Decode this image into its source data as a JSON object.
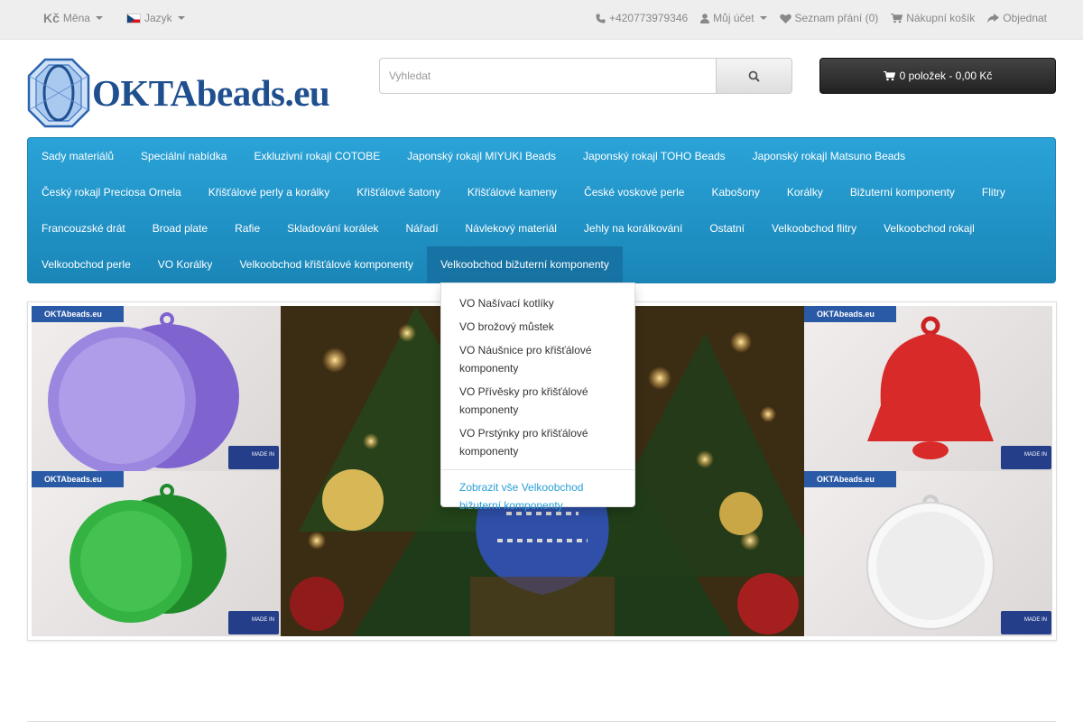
{
  "topbar": {
    "currency_symbol": "Kč",
    "currency_label": "Měna",
    "language_label": "Jazyk",
    "phone": "+420773979346",
    "account": "Můj účet",
    "wishlist": "Seznam přání (0)",
    "cart": "Nákupní košík",
    "checkout": "Objednat"
  },
  "logo": {
    "text": "OKTAbeads.eu"
  },
  "search": {
    "placeholder": "Vyhledat"
  },
  "cart_button": {
    "label": "0 položek - 0,00 Kč"
  },
  "menu": {
    "row1": [
      "Sady materiálů",
      "Speciální nabídka",
      "Exkluzivní rokajl COTOBE",
      "Japonský rokajl MIYUKI Beads",
      "Japonský rokajl TOHO Beads",
      "Japonský rokajl Matsuno Beads"
    ],
    "row2": [
      "Český rokajl Preciosa Ornela",
      "Křišťálové perly a korálky",
      "Křišťálové šatony",
      "Křišťálové kameny",
      "České voskové perle",
      "Kabošony",
      "Korálky",
      "Bižuterní komponenty",
      "Flitry"
    ],
    "row3": [
      "Francouzské drát",
      "Broad plate",
      "Rafie",
      "Skladování korálek",
      "Nářadí",
      "Návlekový materiál",
      "Jehly na korálkování",
      "Ostatní",
      "Velkoobchod flitry",
      "Velkoobchod rokajl"
    ],
    "row4": [
      "Velkoobchod perle",
      "VO Korálky",
      "Velkoobchod křišťálové komponenty",
      "Velkoobchod bižuterní komponenty"
    ]
  },
  "dropdown": {
    "items": [
      "VO Našívací kotlíky",
      "VO brožový můstek",
      "VO Náušnice pro křišťálové komponenty",
      "VO Přívěsky pro křišťálové komponenty",
      "VO Prstýnky pro křišťálové komponenty"
    ],
    "show_all": "Zobrazit vše Velkoobchod bižuterní komponenty"
  },
  "banner": {
    "tile_logo": "OKTAbeads.eu",
    "tile_badge": "MADE IN",
    "tiles": [
      {
        "color": "#8a6fd6",
        "accent": "#6e52c4",
        "shape": "circle"
      },
      {
        "color": "#d92a2a",
        "accent": "#b81f1f",
        "shape": "bell"
      },
      {
        "color": "#2fa93a",
        "accent": "#1f8a2a",
        "shape": "circle"
      },
      {
        "color": "#f4f4f4",
        "accent": "#d8d8d8",
        "shape": "circle"
      }
    ]
  },
  "colors": {
    "menu_bg": "#1a94c8",
    "accent_link": "#2a9fd6"
  }
}
